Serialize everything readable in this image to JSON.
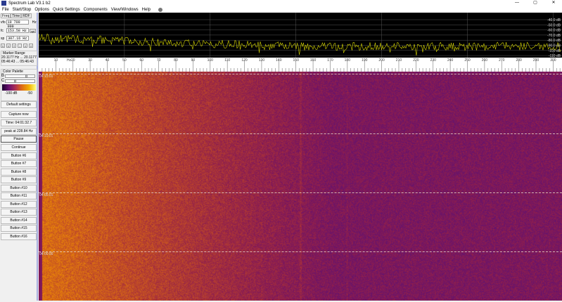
{
  "window": {
    "title": "Spectrum Lab V3.1 b2",
    "minimize": "—",
    "maximize": "▢",
    "close": "✕"
  },
  "menu": [
    "File",
    "Start/Stop",
    "Options",
    "Quick Settings",
    "Components",
    "View/Windows",
    "Help"
  ],
  "left": {
    "tabs": [
      "Freq",
      "Time",
      "RDF"
    ],
    "vfo_label": "vfo",
    "vfo_value": "10 700 000",
    "vfo_unit": "Hz",
    "fc_label": "fc",
    "fc_value": "153.58 Hz",
    "fc_btn": "opt",
    "sp_label": "sp",
    "sp_value": "307.16 Hz",
    "nav_buttons": [
      "<",
      "<",
      "+",
      "-",
      ">",
      ">"
    ],
    "marker_range_title": "Marker Range",
    "marker_range_line1": "20.1177 Hz ... 20.1177 H",
    "marker_range_line2": "05:46:43 ... 05:46:43",
    "palette_title": "Color Palette",
    "palette_b": "B",
    "palette_c": "C",
    "palette_min": "-100 dB",
    "palette_max": "-50",
    "buttons": [
      "Default settings",
      "Capture now",
      "Time:  04:01:32.7",
      "peak at 228.84 Hz",
      "Pause",
      "Continue",
      "Button #6",
      "Button #7",
      "Button #8",
      "Button #9",
      "Button #10",
      "Button #11",
      "Button #12",
      "Button #13",
      "Button #14",
      "Button #15",
      "Button #16"
    ]
  },
  "spectrum": {
    "db_labels": [
      "-40.0 dB",
      "-50.0 dB",
      "-60.0 dB",
      "-70.0 dB",
      "-80.0 dB",
      "-90.0 dB",
      "-100 dB",
      "-110 dB"
    ],
    "trace_color": "#d8d800"
  },
  "freq_scale": {
    "unit": "Hz",
    "labels": [
      "10",
      "20",
      "30",
      "40",
      "50",
      "60",
      "70",
      "80",
      "90",
      "100",
      "110",
      "120",
      "130",
      "140",
      "150",
      "160",
      "170",
      "180",
      "190",
      "200",
      "210",
      "220",
      "230",
      "240",
      "250",
      "260",
      "270",
      "280",
      "290",
      "300"
    ]
  },
  "waterfall": {
    "times": [
      "04:15:01",
      "04:10:01",
      "04:05:01",
      "04:00:00"
    ]
  }
}
